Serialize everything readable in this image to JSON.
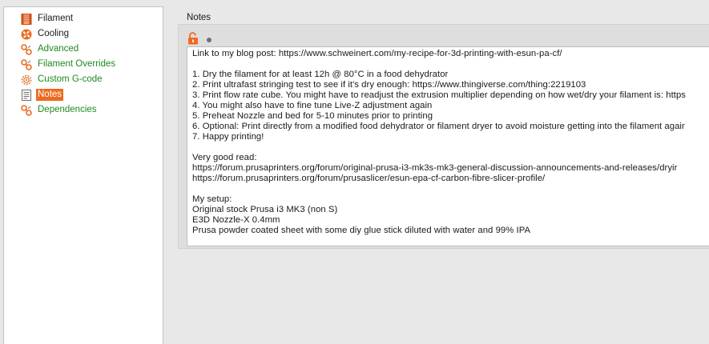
{
  "sidebar": {
    "items": [
      {
        "label": "Filament",
        "icon": "spool-icon",
        "style": "normal"
      },
      {
        "label": "Cooling",
        "icon": "fan-icon",
        "style": "normal"
      },
      {
        "label": "Advanced",
        "icon": "wrench-icon",
        "style": "green"
      },
      {
        "label": "Filament Overrides",
        "icon": "wrench-icon",
        "style": "green"
      },
      {
        "label": "Custom G-code",
        "icon": "gear-icon",
        "style": "green"
      },
      {
        "label": "Notes",
        "icon": "notes-icon",
        "style": "selected"
      },
      {
        "label": "Dependencies",
        "icon": "wrench-icon",
        "style": "green"
      }
    ]
  },
  "page": {
    "title": "Notes"
  },
  "notes": {
    "lines": [
      "Link to my blog post: https://www.schweinert.com/my-recipe-for-3d-printing-with-esun-pa-cf/",
      "",
      "1. Dry the filament for at least 12h @ 80°C in a food dehydrator",
      "2. Print ultrafast stringing test to see if it's dry enough: https://www.thingiverse.com/thing:2219103",
      "3. Print flow rate cube. You might have to readjust the extrusion multiplier depending on how wet/dry your filament is: https",
      "4. You might also have to fine tune Live-Z adjustment again",
      "5. Preheat Nozzle and bed for 5-10 minutes prior to printing",
      "6. Optional: Print directly from a modified food dehydrator or filament dryer to avoid moisture getting into the filament agair",
      "7. Happy printing!",
      "",
      "Very good read:",
      "https://forum.prusaprinters.org/forum/original-prusa-i3-mk3s-mk3-general-discussion-announcements-and-releases/dryir",
      "https://forum.prusaprinters.org/forum/prusaslicer/esun-epa-cf-carbon-fibre-slicer-profile/",
      "",
      "My setup:",
      "Original stock Prusa i3 MK3 (non S)",
      "E3D Nozzle-X 0.4mm",
      "Prusa powder coated sheet with some diy glue stick diluted with water and 99% IPA"
    ]
  },
  "colors": {
    "accent": "#ed6b21",
    "green_text": "#1f8a1f",
    "panel": "#e8e8e8"
  }
}
